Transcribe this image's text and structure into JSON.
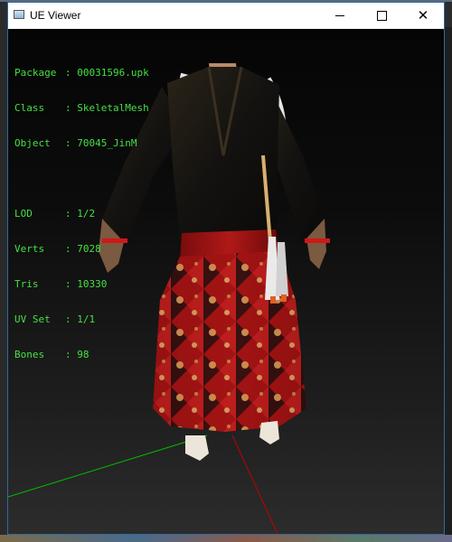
{
  "window": {
    "title": "UE Viewer"
  },
  "info": {
    "package": {
      "label": "Package",
      "value": "00031596.upk"
    },
    "class": {
      "label": "Class",
      "value": "SkeletalMesh"
    },
    "object": {
      "label": "Object",
      "value": "70045_JinM"
    },
    "lod": {
      "label": "LOD",
      "value": "1/2"
    },
    "verts": {
      "label": "Verts",
      "value": "7028"
    },
    "tris": {
      "label": "Tris",
      "value": "10330"
    },
    "uvset": {
      "label": "UV Set",
      "value": "1/1"
    },
    "bones": {
      "label": "Bones",
      "value": "98"
    }
  },
  "colors": {
    "info_text": "#45e045",
    "axis_x": "#c00000",
    "axis_y": "#00c000",
    "robe_red": "#a01010",
    "robe_black": "#141210",
    "flower_gold": "#d8b060"
  },
  "icons": [
    "app-icon",
    "minimize-icon",
    "maximize-icon",
    "close-icon"
  ]
}
